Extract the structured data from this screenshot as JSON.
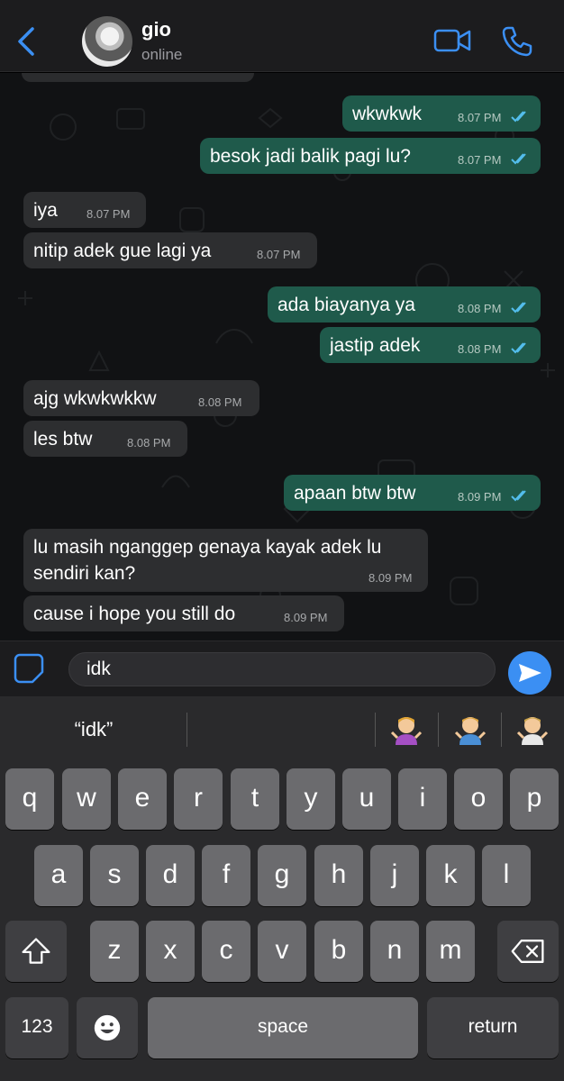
{
  "header": {
    "contact_name": "gio",
    "contact_status": "online",
    "icons": [
      "back-chevron-icon",
      "video-call-icon",
      "phone-icon"
    ],
    "accent_color": "#3b8ff3"
  },
  "messages": [
    {
      "direction": "out",
      "text": "wkwkwk",
      "time": "8.07 PM",
      "read": true
    },
    {
      "direction": "out",
      "text": "besok jadi balik pagi lu?",
      "time": "8.07 PM",
      "read": true
    },
    {
      "direction": "in",
      "text": "iya",
      "time": "8.07 PM"
    },
    {
      "direction": "in",
      "text": "nitip adek gue lagi ya",
      "time": "8.07 PM"
    },
    {
      "direction": "out",
      "text": "ada biayanya ya",
      "time": "8.08 PM",
      "read": true
    },
    {
      "direction": "out",
      "text": "jastip adek",
      "time": "8.08 PM",
      "read": true
    },
    {
      "direction": "in",
      "text": "ajg wkwkwkkw",
      "time": "8.08 PM"
    },
    {
      "direction": "in",
      "text": "les btw",
      "time": "8.08 PM"
    },
    {
      "direction": "out",
      "text": "apaan btw btw",
      "time": "8.09 PM",
      "read": true
    },
    {
      "direction": "in",
      "text_line1": "lu masih nganggep genaya kayak adek lu",
      "text_line2": "sendiri kan?",
      "time": "8.09 PM"
    },
    {
      "direction": "in",
      "text": "cause i hope you still do",
      "time": "8.09 PM"
    }
  ],
  "composer": {
    "value": "idk"
  },
  "keyboard": {
    "suggestion": "“idk”",
    "emoji_suggestions": [
      "person-shrugging-emoji",
      "man-shrugging-emoji",
      "person-shrugging-light-emoji"
    ],
    "row1": [
      "q",
      "w",
      "e",
      "r",
      "t",
      "y",
      "u",
      "i",
      "o",
      "p"
    ],
    "row2": [
      "a",
      "s",
      "d",
      "f",
      "g",
      "h",
      "j",
      "k",
      "l"
    ],
    "row3": [
      "z",
      "x",
      "c",
      "v",
      "b",
      "n",
      "m"
    ],
    "numbers_label": "123",
    "space_label": "space",
    "return_label": "return"
  }
}
